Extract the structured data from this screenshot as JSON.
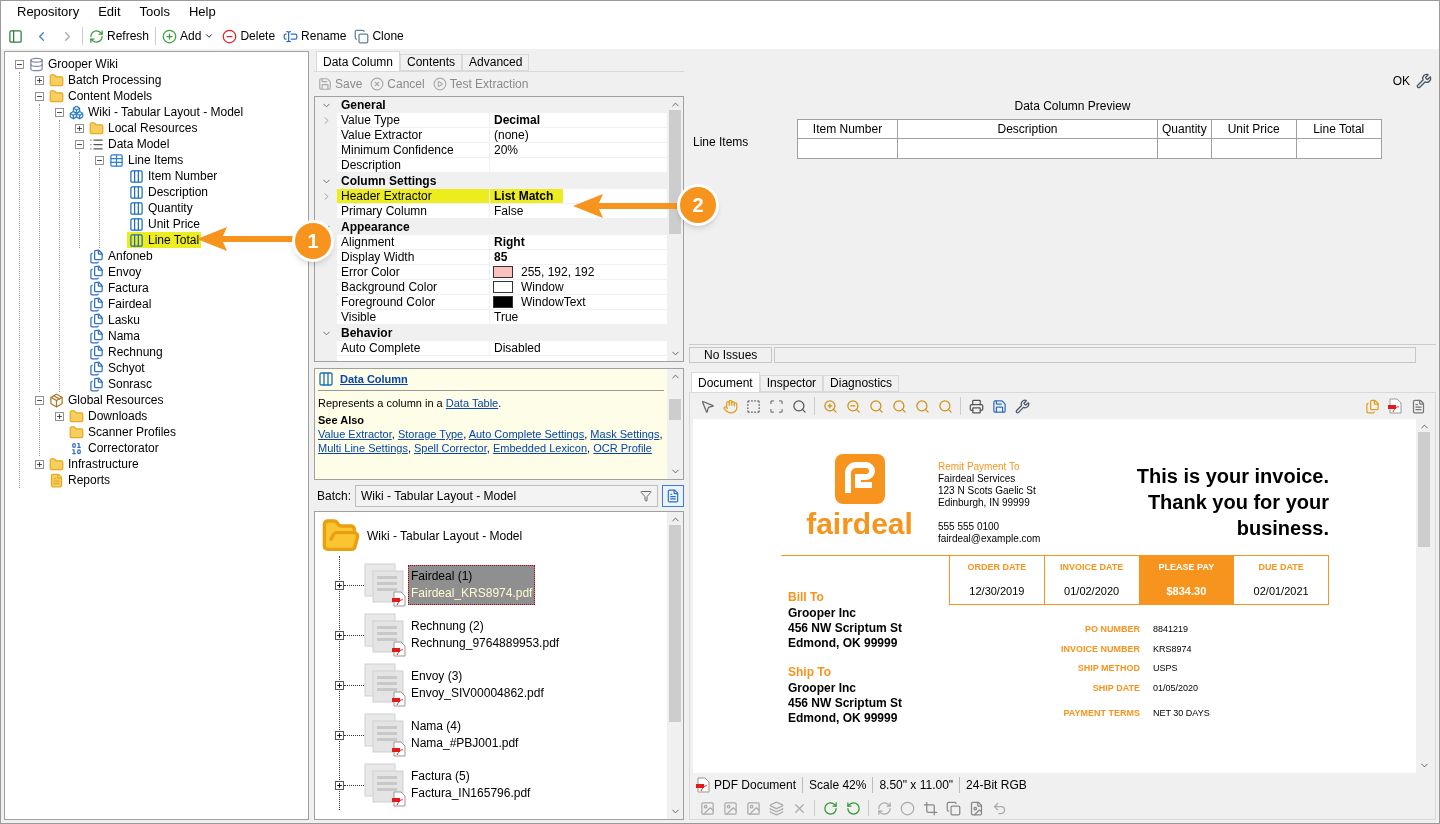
{
  "menu": [
    "Repository",
    "Edit",
    "Tools",
    "Help"
  ],
  "toolbar": [
    {
      "label": "Refresh",
      "dropdown": false
    },
    {
      "label": "Add",
      "dropdown": true
    },
    {
      "label": "Delete",
      "dropdown": false
    },
    {
      "label": "Rename",
      "dropdown": false
    },
    {
      "label": "Clone",
      "dropdown": false
    }
  ],
  "tree": [
    {
      "label": "Grooper Wiki",
      "kind": "database",
      "expanded": true,
      "children": [
        {
          "label": "Batch Processing",
          "kind": "folder",
          "expanded": false
        },
        {
          "label": "Content Models",
          "kind": "folder",
          "expanded": true,
          "children": [
            {
              "label": "Wiki - Tabular Layout - Model",
              "kind": "model",
              "expanded": true,
              "children": [
                {
                  "label": "Local Resources",
                  "kind": "folder",
                  "expanded": false
                },
                {
                  "label": "Data Model",
                  "kind": "datamodel",
                  "expanded": true,
                  "children": [
                    {
                      "label": "Line Items",
                      "kind": "table",
                      "expanded": true,
                      "children": [
                        {
                          "label": "Item Number",
                          "kind": "column",
                          "highlighted": false
                        },
                        {
                          "label": "Description",
                          "kind": "column",
                          "highlighted": false
                        },
                        {
                          "label": "Quantity",
                          "kind": "column",
                          "highlighted": false
                        },
                        {
                          "label": "Unit Price",
                          "kind": "column",
                          "highlighted": false
                        },
                        {
                          "label": "Line Total",
                          "kind": "column",
                          "highlighted": true
                        }
                      ]
                    }
                  ]
                },
                {
                  "label": "Anfoneb",
                  "kind": "doctype"
                },
                {
                  "label": "Envoy",
                  "kind": "doctype"
                },
                {
                  "label": "Factura",
                  "kind": "doctype"
                },
                {
                  "label": "Fairdeal",
                  "kind": "doctype"
                },
                {
                  "label": "Lasku",
                  "kind": "doctype"
                },
                {
                  "label": "Nama",
                  "kind": "doctype"
                },
                {
                  "label": "Rechnung",
                  "kind": "doctype"
                },
                {
                  "label": "Schyot",
                  "kind": "doctype"
                },
                {
                  "label": "Sonrasc",
                  "kind": "doctype"
                }
              ]
            }
          ]
        },
        {
          "label": "Global Resources",
          "kind": "package",
          "expanded": true,
          "children": [
            {
              "label": "Downloads",
              "kind": "folder",
              "expanded": false
            },
            {
              "label": "Scanner Profiles",
              "kind": "folder"
            },
            {
              "label": "Correctorator",
              "kind": "lexicon"
            }
          ]
        },
        {
          "label": "Infrastructure",
          "kind": "folder",
          "expanded": false
        },
        {
          "label": "Reports",
          "kind": "report"
        }
      ]
    }
  ],
  "editor": {
    "tabs": [
      {
        "label": "Data Column",
        "selected": true
      },
      {
        "label": "Contents",
        "selected": false
      },
      {
        "label": "Advanced",
        "selected": false
      }
    ],
    "actions": [
      {
        "label": "Save",
        "disabled": true
      },
      {
        "label": "Cancel",
        "disabled": true
      },
      {
        "label": "Test Extraction",
        "disabled": true
      }
    ],
    "categories": [
      {
        "name": "General",
        "expanded": true,
        "rows": [
          {
            "name": "Value Type",
            "value": "Decimal",
            "bold": true,
            "expandable": true,
            "highlighted": false
          },
          {
            "name": "Value Extractor",
            "value": "(none)",
            "bold": false,
            "expandable": false,
            "highlighted": false
          },
          {
            "name": "Minimum Confidence",
            "value": "20%",
            "bold": false,
            "expandable": false,
            "highlighted": false
          },
          {
            "name": "Description",
            "expandable": false,
            "highlighted": false
          }
        ]
      },
      {
        "name": "Column Settings",
        "expanded": true,
        "rows": [
          {
            "name": "Header Extractor",
            "value": "List Match",
            "bold": true,
            "expandable": true,
            "highlighted": true
          },
          {
            "name": "Primary Column",
            "value": "False",
            "bold": false,
            "expandable": false,
            "highlighted": false
          }
        ]
      },
      {
        "name": "Appearance",
        "expanded": true,
        "rows": [
          {
            "name": "Alignment",
            "value": "Right",
            "bold": true,
            "expandable": false,
            "highlighted": false
          },
          {
            "name": "Display Width",
            "value": "85",
            "bold": true,
            "expandable": false,
            "highlighted": false
          },
          {
            "name": "Error Color",
            "value": "255, 192, 192",
            "color": "#ffc0c0",
            "bold": false,
            "expandable": false,
            "highlighted": false
          },
          {
            "name": "Background Color",
            "value": "Window",
            "color": "#ffffff",
            "bold": false,
            "expandable": false,
            "highlighted": false
          },
          {
            "name": "Foreground Color",
            "value": "WindowText",
            "color": "#000000",
            "bold": false,
            "expandable": false,
            "highlighted": false
          },
          {
            "name": "Visible",
            "value": "True",
            "bold": false,
            "expandable": false,
            "highlighted": false
          }
        ]
      },
      {
        "name": "Behavior",
        "expanded": true,
        "rows": [
          {
            "name": "Auto Complete",
            "value": "Disabled",
            "bold": false,
            "expandable": false,
            "highlighted": false
          }
        ]
      }
    ],
    "help": {
      "title": "Data Column",
      "text_before": "Represents a column in a ",
      "text_link": "Data Table",
      "text_after": ".",
      "see_also": "See Also",
      "separator": ",",
      "links": [
        "Value Extractor",
        "Storage Type",
        "Auto Complete Settings",
        "Mask Settings",
        "Multi Line Settings",
        "Spell Corrector",
        "Embedded Lexicon",
        "OCR Profile"
      ]
    }
  },
  "batch": {
    "label": "Batch:",
    "value": "Wiki - Tabular Layout - Model",
    "root": "Wiki - Tabular Layout - Model",
    "documents": [
      {
        "name": "Fairdeal (1)",
        "file": "Fairdeal_KRS8974.pdf",
        "selected": true
      },
      {
        "name": "Rechnung (2)",
        "file": "Rechnung_9764889953.pdf",
        "selected": false
      },
      {
        "name": "Envoy (3)",
        "file": "Envoy_SIV00004862.pdf",
        "selected": false
      },
      {
        "name": "Nama (4)",
        "file": "Nama_#PBJ001.pdf",
        "selected": false
      },
      {
        "name": "Factura (5)",
        "file": "Factura_IN165796.pdf",
        "selected": false
      }
    ]
  },
  "preview": {
    "ok": "OK",
    "title": "Data Column Preview",
    "table_label": "Line Items",
    "columns": [
      "Item Number",
      "Description",
      "Quantity",
      "Unit Price",
      "Line Total"
    ],
    "status": "No Issues"
  },
  "viewer": {
    "tabs": [
      {
        "label": "Document",
        "selected": true
      },
      {
        "label": "Inspector",
        "selected": false
      },
      {
        "label": "Diagnostics",
        "selected": false
      }
    ],
    "invoice": {
      "brand": "fairdeal",
      "remit_title": "Remit Payment To",
      "remit_lines": [
        "Fairdeal Services",
        "123 N Scots Gaelic St",
        "Edinburgh, IN 99999"
      ],
      "contact_lines": [
        "555 555 0100",
        "fairdeal@example.com"
      ],
      "headline": "This is your invoice. Thank you for your business.",
      "dates": [
        {
          "label": "ORDER DATE",
          "value": "12/30/2019",
          "highlighted": false
        },
        {
          "label": "INVOICE DATE",
          "value": "01/02/2020",
          "highlighted": false
        },
        {
          "label": "PLEASE PAY",
          "value": "$834.30",
          "highlighted": true
        },
        {
          "label": "DUE DATE",
          "value": "02/01/2021",
          "highlighted": false
        }
      ],
      "addresses": [
        {
          "title": "Bill To",
          "lines": [
            "Grooper Inc",
            "456 NW Scriptum St",
            "Edmond, OK 99999"
          ]
        },
        {
          "title": "Ship To",
          "lines": [
            "Grooper Inc",
            "456 NW Scriptum St",
            "Edmond, OK 99999"
          ]
        }
      ],
      "details": [
        {
          "label": "PO NUMBER",
          "value": "8841219"
        },
        {
          "label": "INVOICE NUMBER",
          "value": "KRS8974"
        },
        {
          "label": "SHIP METHOD",
          "value": "USPS"
        },
        {
          "label": "SHIP DATE",
          "value": "01/05/2020"
        },
        {
          "label": "PAYMENT TERMS",
          "value": "NET 30 DAYS"
        }
      ]
    },
    "status": [
      "PDF Document",
      "Scale 42%",
      "8.50\" x 11.00\"",
      "24-Bit RGB"
    ]
  },
  "callouts": [
    {
      "label": "1"
    },
    {
      "label": "2"
    }
  ]
}
